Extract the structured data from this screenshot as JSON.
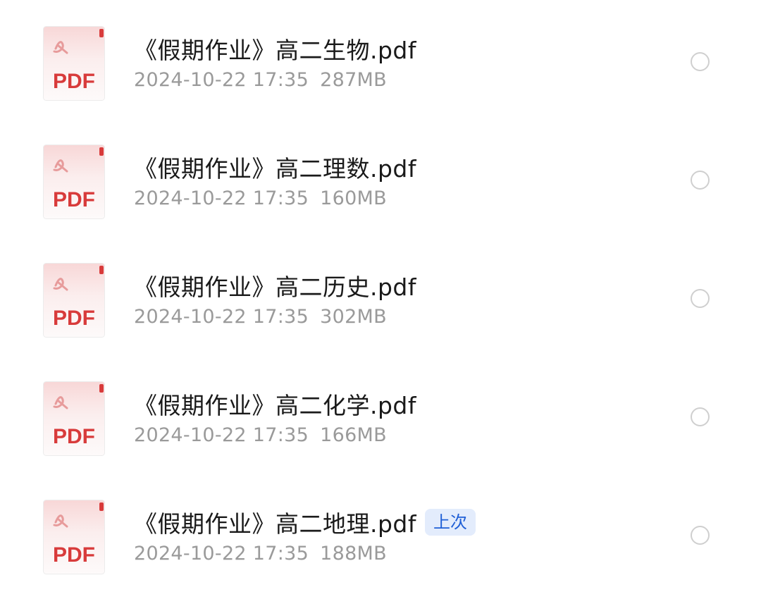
{
  "files": [
    {
      "icon": "pdf-file-icon",
      "icon_label": "PDF",
      "name": "《假期作业》高二生物.pdf",
      "date": "2024-10-22 17:35",
      "size": "287MB",
      "badge": ""
    },
    {
      "icon": "pdf-file-icon",
      "icon_label": "PDF",
      "name": "《假期作业》高二理数.pdf",
      "date": "2024-10-22 17:35",
      "size": "160MB",
      "badge": ""
    },
    {
      "icon": "pdf-file-icon",
      "icon_label": "PDF",
      "name": "《假期作业》高二历史.pdf",
      "date": "2024-10-22 17:35",
      "size": "302MB",
      "badge": ""
    },
    {
      "icon": "pdf-file-icon",
      "icon_label": "PDF",
      "name": "《假期作业》高二化学.pdf",
      "date": "2024-10-22 17:35",
      "size": "166MB",
      "badge": ""
    },
    {
      "icon": "pdf-file-icon",
      "icon_label": "PDF",
      "name": "《假期作业》高二地理.pdf",
      "date": "2024-10-22 17:35",
      "size": "188MB",
      "badge": "上次"
    }
  ],
  "colors": {
    "pdf_red": "#d83b3b",
    "name_text": "#1a1a1a",
    "meta_text": "#9a9a9a",
    "badge_bg": "#e3ecfc",
    "badge_text": "#1f5fd6",
    "radio_border": "#cfcfcf"
  }
}
